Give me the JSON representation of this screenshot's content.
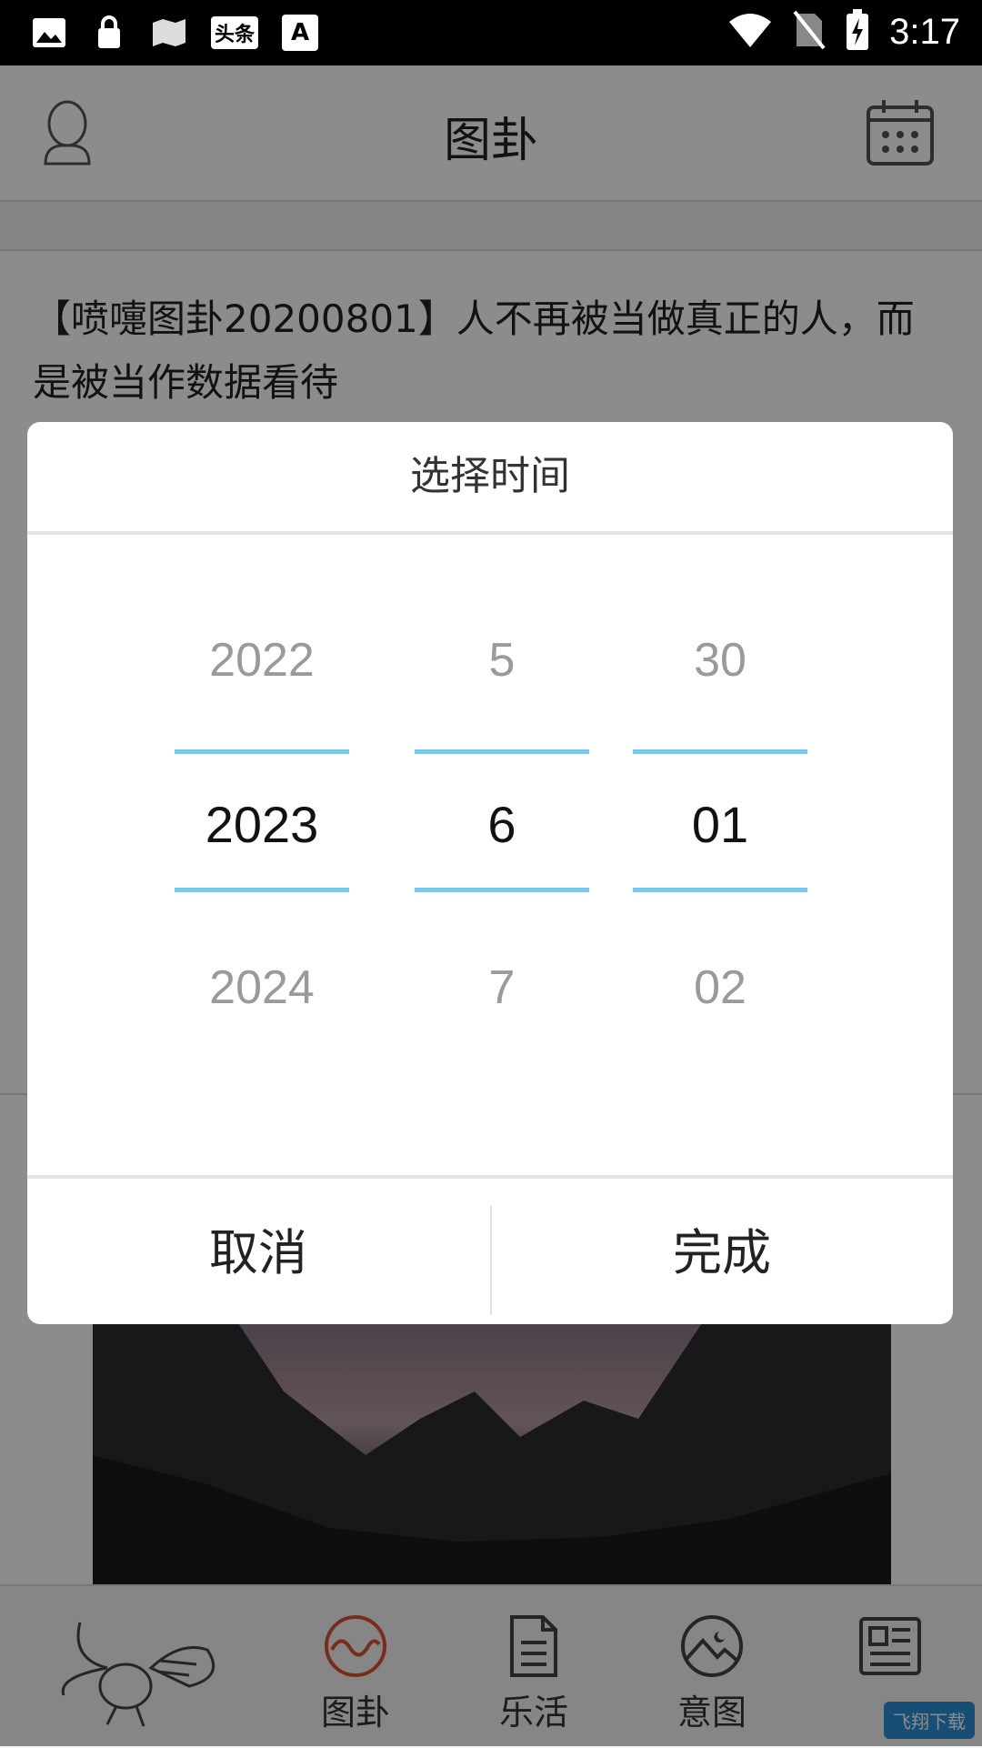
{
  "status_bar": {
    "time": "3:17",
    "news_icon_text": "头条",
    "font_icon_text": "A"
  },
  "header": {
    "title": "图卦"
  },
  "article": {
    "headline": "【喷嚏图卦20200801】人不再被当做真正的人，而是被当作数据看待"
  },
  "dialog": {
    "title": "选择时间",
    "columns": [
      {
        "name": "year",
        "prev": "2022",
        "selected": "2023",
        "next": "2024"
      },
      {
        "name": "month",
        "prev": "5",
        "selected": "6",
        "next": "7"
      },
      {
        "name": "day",
        "prev": "30",
        "selected": "01",
        "next": "02"
      }
    ],
    "cancel_label": "取消",
    "confirm_label": "完成"
  },
  "bottom_nav": {
    "items": [
      {
        "label": "图卦",
        "icon": "wave-circle-icon"
      },
      {
        "label": "乐活",
        "icon": "document-icon"
      },
      {
        "label": "意图",
        "icon": "picture-circle-icon"
      },
      {
        "label": "",
        "icon": "newspaper-icon"
      }
    ]
  },
  "watermark": "飞翔下载",
  "colors": {
    "accent_line": "#7cc7e6",
    "active_icon": "#d9532f"
  }
}
